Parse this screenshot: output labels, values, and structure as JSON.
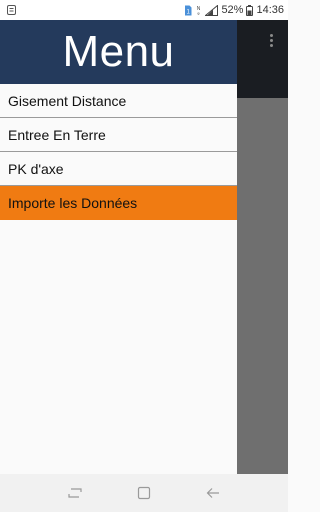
{
  "status_bar": {
    "battery": "52%",
    "time": "14:36",
    "icons": [
      "notification-icon",
      "sim-icon",
      "nfc-icon",
      "signal-icon",
      "battery-icon"
    ]
  },
  "drawer": {
    "title": "Menu",
    "items": [
      {
        "label": "Gisement Distance",
        "active": false
      },
      {
        "label": "Entree En Terre",
        "active": false
      },
      {
        "label": "PK d'axe",
        "active": false
      },
      {
        "label": "Importe les Données",
        "active": true
      }
    ]
  },
  "colors": {
    "header": "#243a5c",
    "active_item": "#f07b12",
    "drawer_bg": "#fafafa",
    "scrim": "#6f6f6f"
  },
  "nav_bar": {
    "icons": [
      "recents-icon",
      "home-icon",
      "back-icon"
    ]
  }
}
